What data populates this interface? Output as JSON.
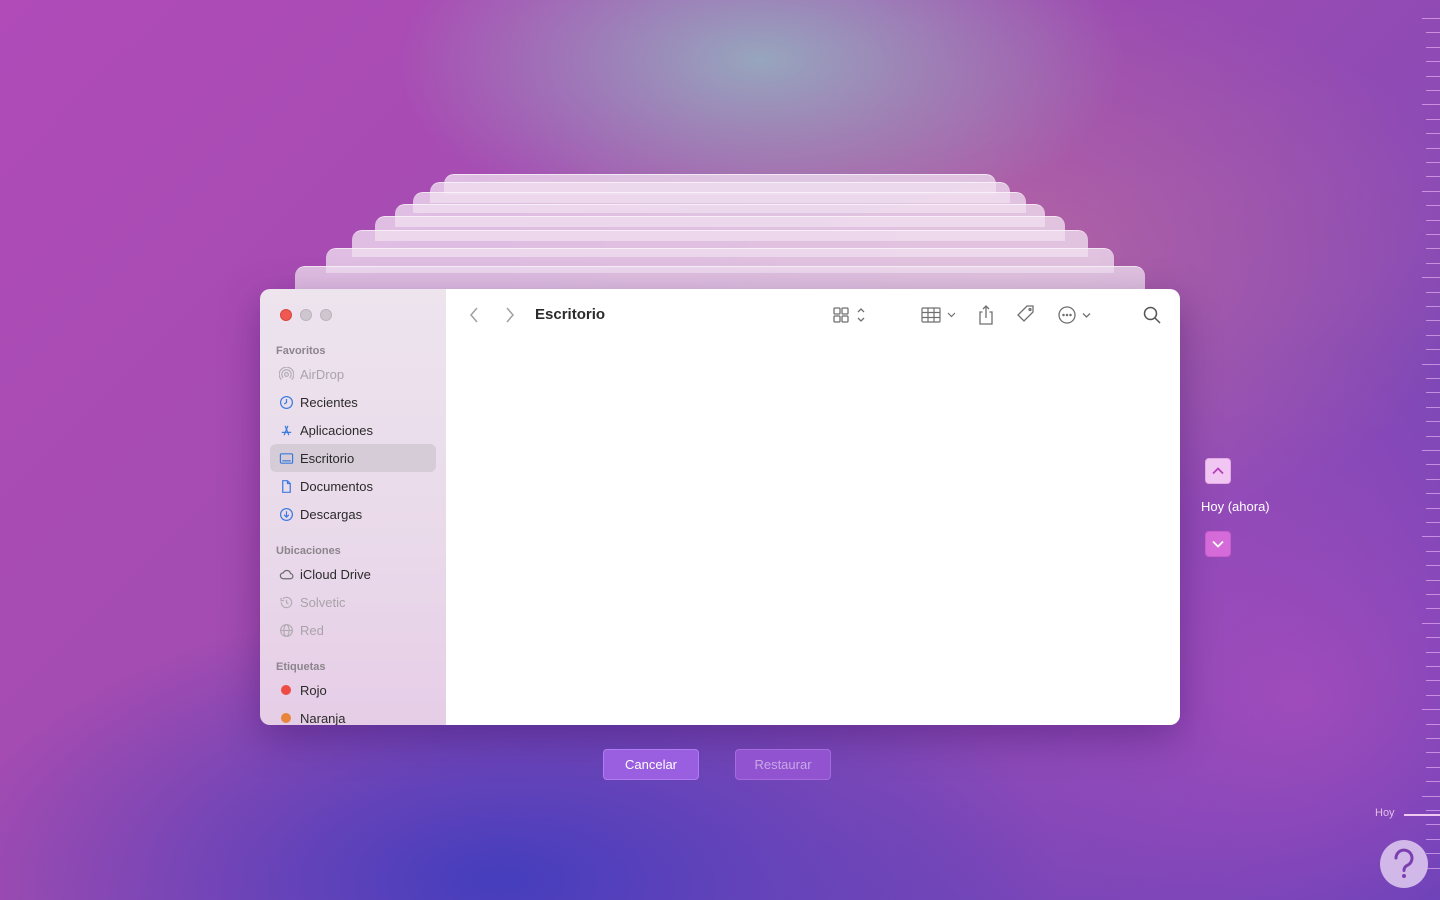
{
  "finder": {
    "path_title": "Escritorio",
    "sidebar": {
      "favoritos_title": "Favoritos",
      "favoritos": [
        {
          "label": "AirDrop",
          "icon": "airdrop-icon",
          "state": "disabled"
        },
        {
          "label": "Recientes",
          "icon": "clock-icon",
          "state": "normal"
        },
        {
          "label": "Aplicaciones",
          "icon": "apps-icon",
          "state": "normal"
        },
        {
          "label": "Escritorio",
          "icon": "desktop-icon",
          "state": "selected"
        },
        {
          "label": "Documentos",
          "icon": "document-icon",
          "state": "normal"
        },
        {
          "label": "Descargas",
          "icon": "download-icon",
          "state": "normal"
        }
      ],
      "ubicaciones_title": "Ubicaciones",
      "ubicaciones": [
        {
          "label": "iCloud Drive",
          "icon": "cloud-icon",
          "state": "normal"
        },
        {
          "label": "Solvetic",
          "icon": "time-machine-icon",
          "state": "disabled"
        },
        {
          "label": "Red",
          "icon": "globe-icon",
          "state": "disabled"
        }
      ],
      "etiquetas_title": "Etiquetas",
      "etiquetas": [
        {
          "label": "Rojo",
          "color": "#ee4b45"
        },
        {
          "label": "Naranja",
          "color": "#e8853a"
        }
      ]
    }
  },
  "buttons": {
    "cancel_label": "Cancelar",
    "restore_label": "Restaurar"
  },
  "timemachine": {
    "current_label": "Hoy (ahora)",
    "timeline_label": "Hoy"
  },
  "colors": {
    "accent": "#9a5ee0",
    "selected_row": "#d6ccd7"
  }
}
